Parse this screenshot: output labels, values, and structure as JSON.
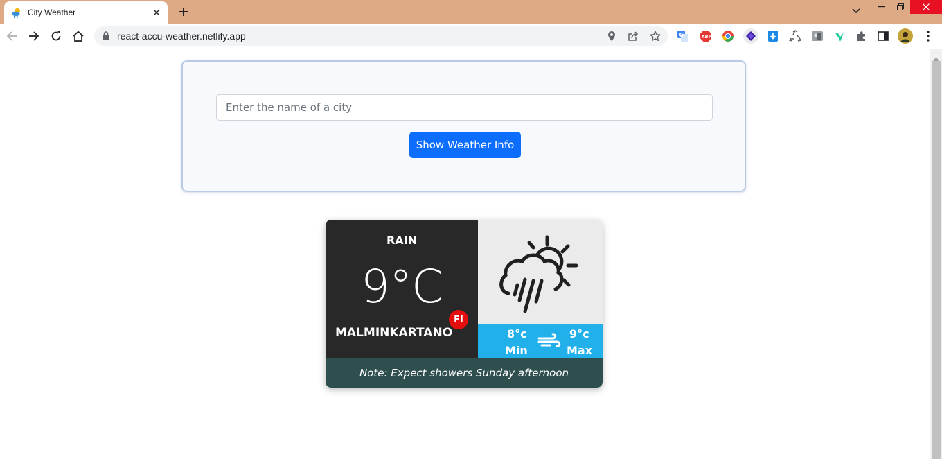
{
  "browser": {
    "tab_title": "City Weather",
    "url": "react-accu-weather.netlify.app",
    "extensions": [
      "translate-icon",
      "adblock-icon",
      "chrome-color-icon",
      "layers-icon",
      "download-icon",
      "recycle-icon",
      "photo-icon",
      "bird-icon",
      "puzzle-icon",
      "side-panel-icon",
      "profile-avatar",
      "menu-icon"
    ]
  },
  "search": {
    "placeholder": "Enter the name of a city",
    "value": "",
    "button_label": "Show Weather Info"
  },
  "weather": {
    "condition": "RAIN",
    "temperature": "9°C",
    "city": "MALMINKARTANO",
    "country_code": "FI",
    "min_value": "8°c",
    "min_label": "Min",
    "max_value": "9°c",
    "max_label": "Max",
    "note": "Note: Expect showers Sunday afternoon",
    "icon": "rain-sun-cloud-icon"
  },
  "colors": {
    "tabbar": "#dea985",
    "button": "#0d6efd",
    "card_dark": "#282828",
    "card_light": "#ebebeb",
    "minmax": "#21b0ea",
    "note": "#2f4f4f",
    "badge": "#e50d0d"
  }
}
